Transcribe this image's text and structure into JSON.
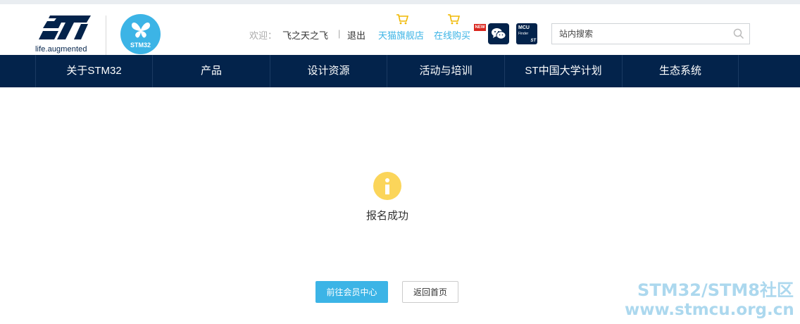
{
  "brand": {
    "tagline": "life.augmented",
    "badge_text": "STM32"
  },
  "user_bar": {
    "welcome": "欢迎：",
    "username": "飞之天之飞",
    "separator": "|",
    "logout": "退出"
  },
  "shop_links": [
    {
      "label": "天猫旗舰店",
      "icon": "shopping-cart-icon"
    },
    {
      "label": "在线购买",
      "icon": "shopping-cart-icon",
      "badge": "NEW"
    }
  ],
  "social": {
    "wechat_icon": "wechat-icon",
    "mcu_finder": {
      "title": "MCU",
      "subtitle": "Finder",
      "brand": "ST"
    }
  },
  "search": {
    "placeholder": "站内搜索",
    "value": "",
    "icon": "search-icon"
  },
  "nav": {
    "items": [
      {
        "label": "关于STM32"
      },
      {
        "label": "产品"
      },
      {
        "label": "设计资源"
      },
      {
        "label": "活动与培训"
      },
      {
        "label": "ST中国大学计划"
      },
      {
        "label": "生态系统"
      }
    ]
  },
  "main": {
    "status_icon": "info-icon",
    "message": "报名成功",
    "buttons": {
      "member_center": "前往会员中心",
      "back_home": "返回首页"
    }
  },
  "watermark": {
    "line1": "STM32/STM8社区",
    "line2": "www.stmcu.org.cn"
  },
  "colors": {
    "nav_bg": "#03234b",
    "accent": "#3cb4e6",
    "info_icon": "#fbd55a",
    "watermark": "#a8d6ee"
  }
}
